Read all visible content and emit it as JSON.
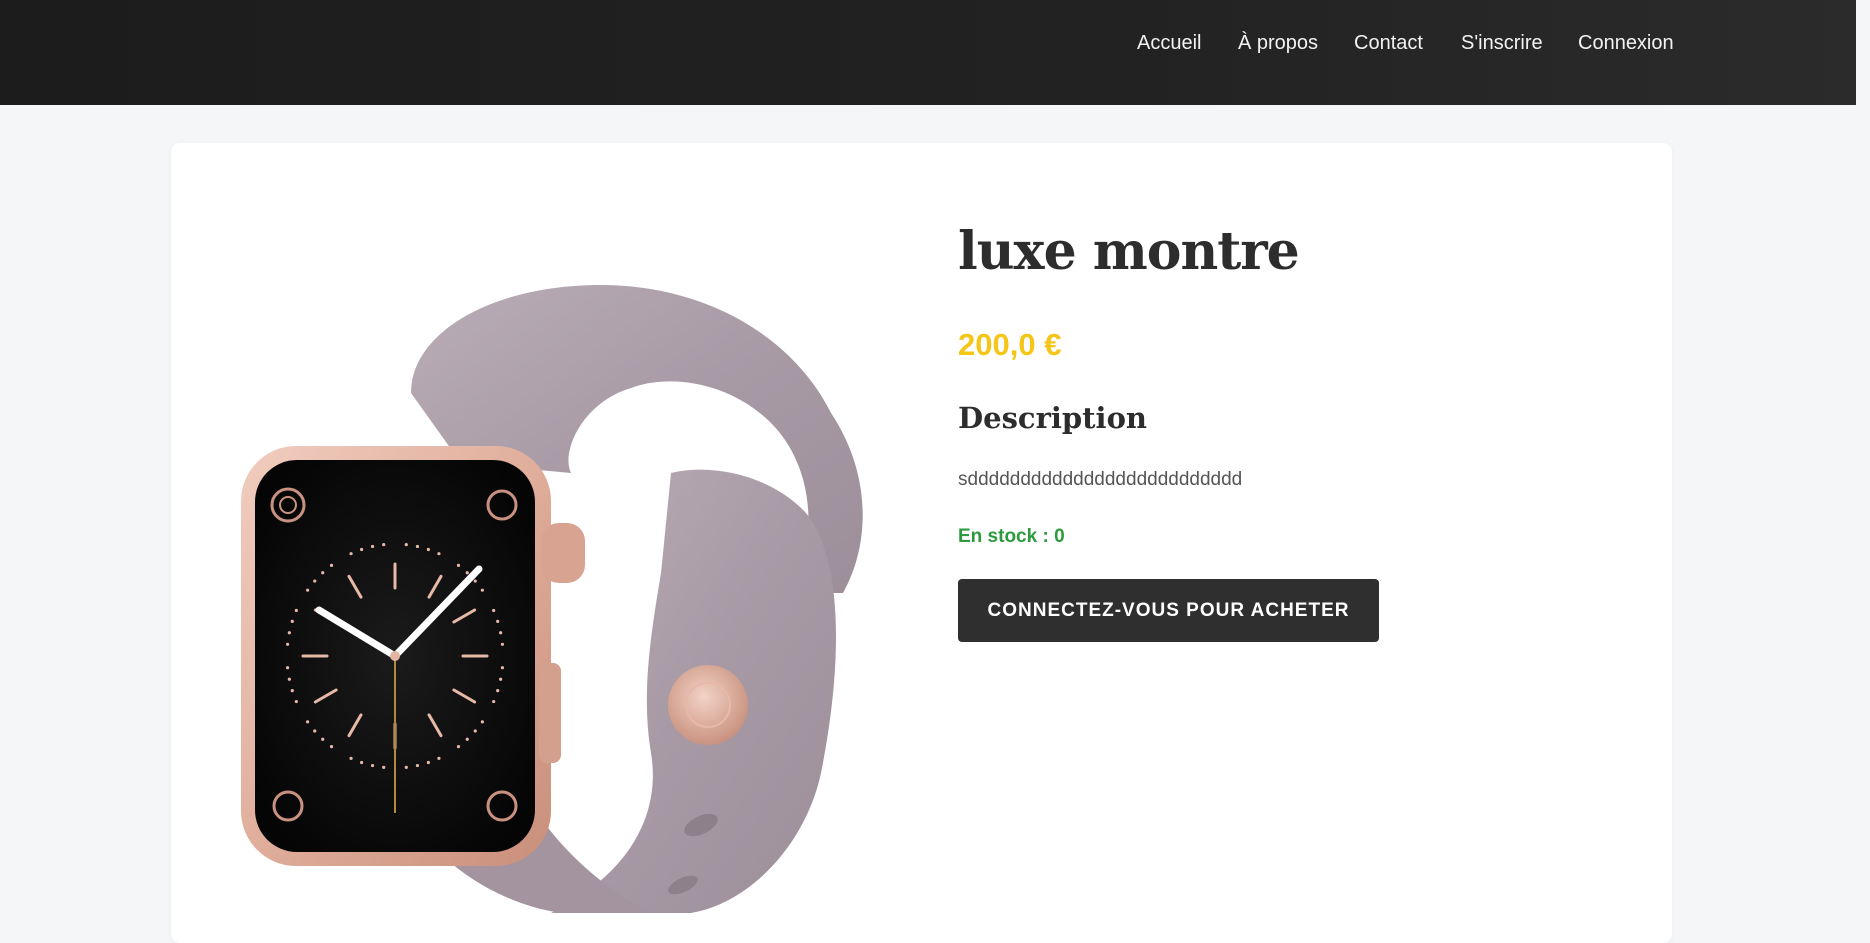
{
  "nav": {
    "items": [
      "Accueil",
      "À propos",
      "Contact",
      "S'inscrire",
      "Connexion"
    ]
  },
  "product": {
    "title": "luxe montre",
    "price": "200,0 €",
    "description_heading": "Description",
    "description": "sdddddddddddddddddddddddddd",
    "stock": "En stock : 0",
    "buy_button": "CONNECTEZ-VOUS POUR ACHETER"
  },
  "colors": {
    "navbar": "#1f1f1f",
    "price": "#f5c518",
    "stock": "#2e9a3e",
    "button": "#2f2f2f",
    "band": "#aea0ab",
    "case": "#e2b4a2"
  }
}
